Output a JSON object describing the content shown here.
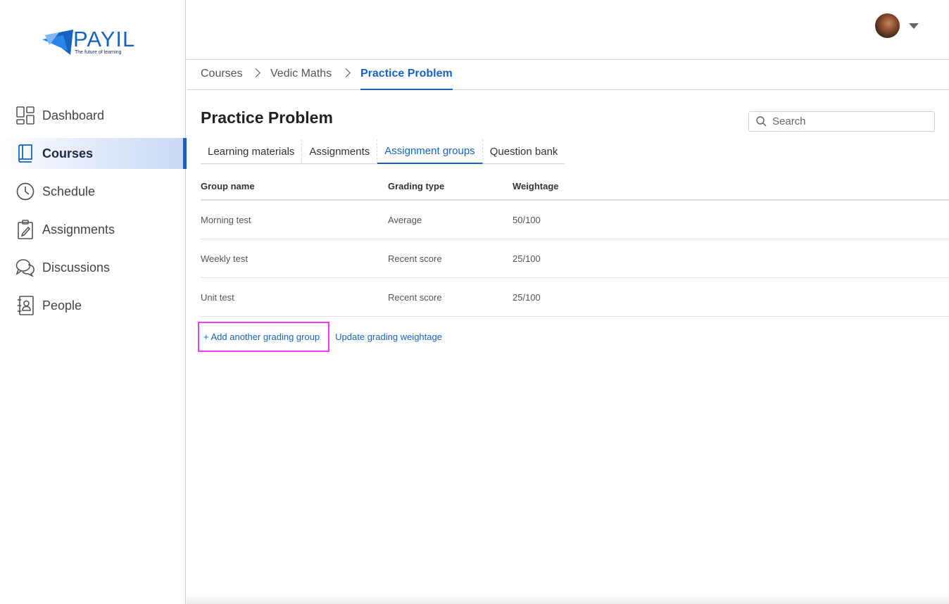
{
  "brand": {
    "name": "PAYIL",
    "tagline": "The future of learning"
  },
  "sidebar": {
    "items": [
      {
        "label": "Dashboard",
        "icon": "dashboard-icon"
      },
      {
        "label": "Courses",
        "icon": "book-icon",
        "active": true
      },
      {
        "label": "Schedule",
        "icon": "clock-icon"
      },
      {
        "label": "Assignments",
        "icon": "clipboard-icon"
      },
      {
        "label": "Discussions",
        "icon": "chat-icon"
      },
      {
        "label": "People",
        "icon": "contacts-icon"
      }
    ]
  },
  "header": {
    "avatar_icon": "user-avatar",
    "menu_icon": "chevron-down-icon"
  },
  "breadcrumb": [
    "Courses",
    "Vedic Maths",
    "Practice Problem"
  ],
  "main": {
    "title": "Practice Problem",
    "search": {
      "placeholder": "Search",
      "icon": "search-icon"
    },
    "tabs": [
      {
        "label": "Learning materials"
      },
      {
        "label": "Assignments"
      },
      {
        "label": "Assignment groups",
        "active": true
      },
      {
        "label": "Question bank"
      }
    ],
    "table": {
      "headers": [
        "Group name",
        "Grading type",
        "Weightage"
      ],
      "rows": [
        [
          "Morning test",
          "Average",
          "50/100"
        ],
        [
          "Weekly test",
          "Recent score",
          "25/100"
        ],
        [
          "Unit test",
          "Recent score",
          "25/100"
        ]
      ]
    },
    "actions": {
      "add_group": "+ Add another grading group",
      "update_weightage": "Update grading weightage"
    }
  },
  "colors": {
    "accent": "#1764c0",
    "highlight": "#f23cf0"
  }
}
